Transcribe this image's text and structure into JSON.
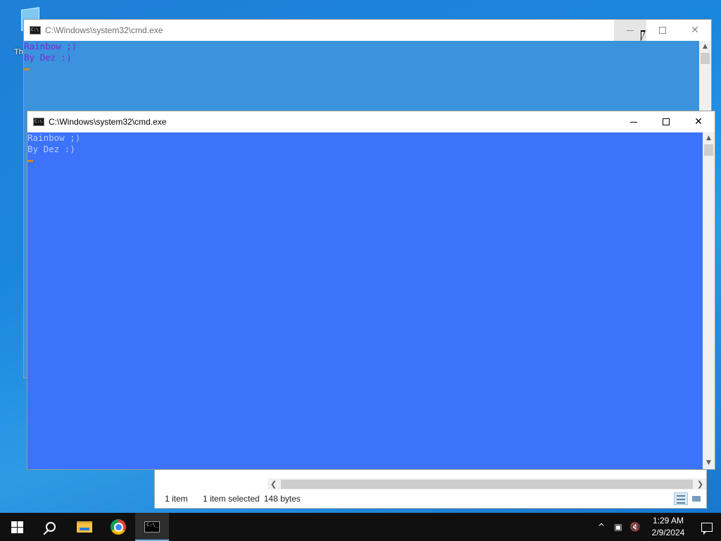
{
  "desktop": {
    "icon_label": "Th"
  },
  "explorer": {
    "status_items": "1 item",
    "status_selected": "1 item selected",
    "status_size": "148 bytes"
  },
  "cmd_back": {
    "title": "C:\\Windows\\system32\\cmd.exe",
    "lines": [
      "Rainbow ;)",
      "By Dez :)"
    ],
    "background": "#3a93dc",
    "text_color": "#7a2bd8"
  },
  "cmd_front": {
    "title": "C:\\Windows\\system32\\cmd.exe",
    "lines": [
      "Rainbow ;)",
      "By Dez :)"
    ],
    "background": "#3c73fb",
    "text_color": "#b9cff8"
  },
  "taskbar": {
    "items": [
      "start-icon",
      "search-icon",
      "file-explorer-icon",
      "chrome-icon",
      "cmd-icon"
    ],
    "clock_time": "1:29 AM",
    "clock_date": "2/9/2024",
    "tray_chevron": "^"
  }
}
